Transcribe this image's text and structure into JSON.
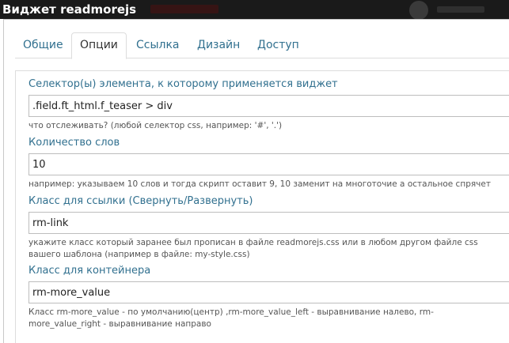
{
  "window": {
    "title": "Виджет readmorejs"
  },
  "tabs": [
    {
      "label": "Общие"
    },
    {
      "label": "Опции"
    },
    {
      "label": "Ссылка"
    },
    {
      "label": "Дизайн"
    },
    {
      "label": "Доступ"
    }
  ],
  "active_tab": "Опции",
  "fields": {
    "selector": {
      "label": "Селектор(ы) элемента, к которому применяется виджет",
      "value": ".field.ft_html.f_teaser > div",
      "help": "что отслеживать? (любой селектор css, например: '#', '.')"
    },
    "word_count": {
      "label": "Количество слов",
      "value": "10",
      "help": "например: указываем 10 слов и тогда скрипт оставит 9, 10 заменит на многоточие а остальное спрячет"
    },
    "link_class": {
      "label": "Класс для ссылки (Свернуть/Развернуть)",
      "value": "rm-link",
      "help": "укажите класс который заранее был прописан в файле readmorejs.css или в любом другом файле css вашего шаблона (например в файле: my-style.css)"
    },
    "container_class": {
      "label": "Класс для контейнера",
      "value": "rm-more_value",
      "help": "Класс rm-more_value - по умолчанию(центр) ,rm-more_value_left - выравнивание налево, rm-more_value_right - выравнивание направо"
    }
  }
}
